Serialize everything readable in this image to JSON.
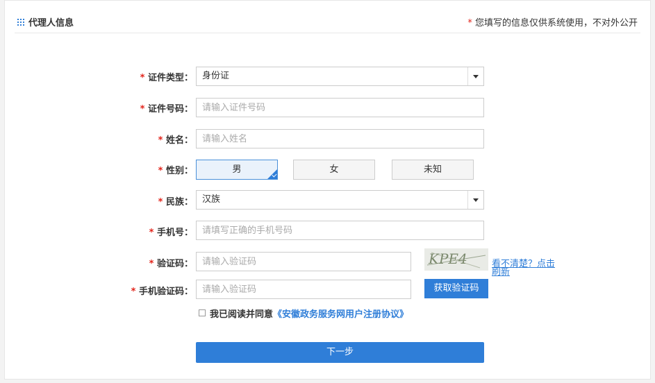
{
  "header": {
    "title": "代理人信息",
    "note_star": "*",
    "note": "您填写的信息仅供系统使用，不对外公开"
  },
  "form": {
    "id_type": {
      "star": "*",
      "label": "证件类型：",
      "value": "身份证"
    },
    "id_number": {
      "star": "*",
      "label": "证件号码：",
      "placeholder": "请输入证件号码"
    },
    "name": {
      "star": "*",
      "label": "姓名：",
      "placeholder": "请输入姓名"
    },
    "gender": {
      "star": "*",
      "label": "性别：",
      "options": [
        "男",
        "女",
        "未知"
      ],
      "selected": "男"
    },
    "ethnicity": {
      "star": "*",
      "label": "民族：",
      "value": "汉族"
    },
    "phone": {
      "star": "*",
      "label": "手机号：",
      "placeholder": "请填写正确的手机号码"
    },
    "captcha": {
      "star": "*",
      "label": "验证码：",
      "placeholder": "请输入验证码",
      "refresh_text": "看不清楚？点击刷新",
      "image_text": "KPE4"
    },
    "sms_code": {
      "star": "*",
      "label": "手机验证码：",
      "placeholder": "请输入验证码",
      "button": "获取验证码"
    }
  },
  "agreement": {
    "text": "我已阅读并同意",
    "link": "《安徽政务服务网用户注册协议》"
  },
  "next_button": "下一步",
  "colors": {
    "accent": "#2f7ed8",
    "required": "#e2231a"
  }
}
